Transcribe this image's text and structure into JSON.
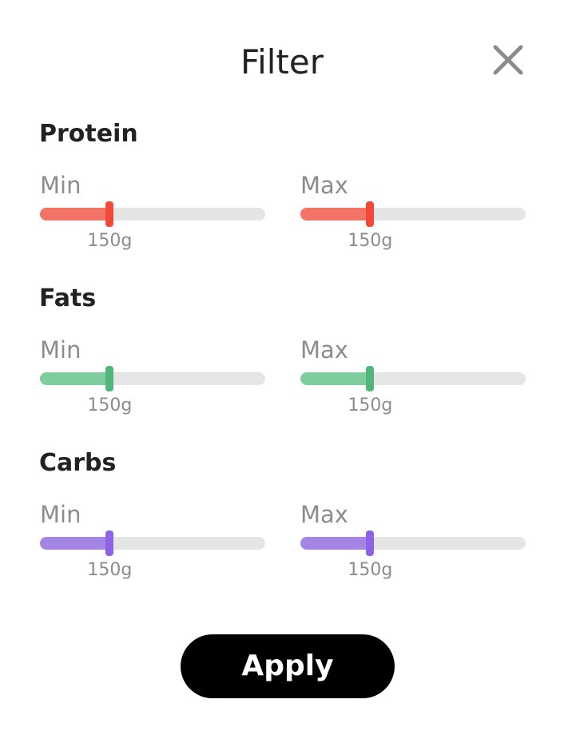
{
  "header": {
    "title": "Filter",
    "close_icon": "close-icon"
  },
  "colors": {
    "protein": "#f27466",
    "protein_thumb": "#f2493a",
    "fats": "#7fcc9f",
    "fats_thumb": "#52b57a",
    "carbs": "#a585e4",
    "carbs_thumb": "#8e61e6",
    "track": "#e5e5e5",
    "muted_text": "#8c8c8c"
  },
  "sections": [
    {
      "key": "protein",
      "title": "Protein",
      "min": {
        "label": "Min",
        "value_label": "150g",
        "level_percent": 31
      },
      "max": {
        "label": "Max",
        "value_label": "150g",
        "level_percent": 31
      }
    },
    {
      "key": "fats",
      "title": "Fats",
      "min": {
        "label": "Min",
        "value_label": "150g",
        "level_percent": 31
      },
      "max": {
        "label": "Max",
        "value_label": "150g",
        "level_percent": 31
      }
    },
    {
      "key": "carbs",
      "title": "Carbs",
      "min": {
        "label": "Min",
        "value_label": "150g",
        "level_percent": 31
      },
      "max": {
        "label": "Max",
        "value_label": "150g",
        "level_percent": 31
      }
    }
  ],
  "footer": {
    "apply_label": "Apply"
  }
}
